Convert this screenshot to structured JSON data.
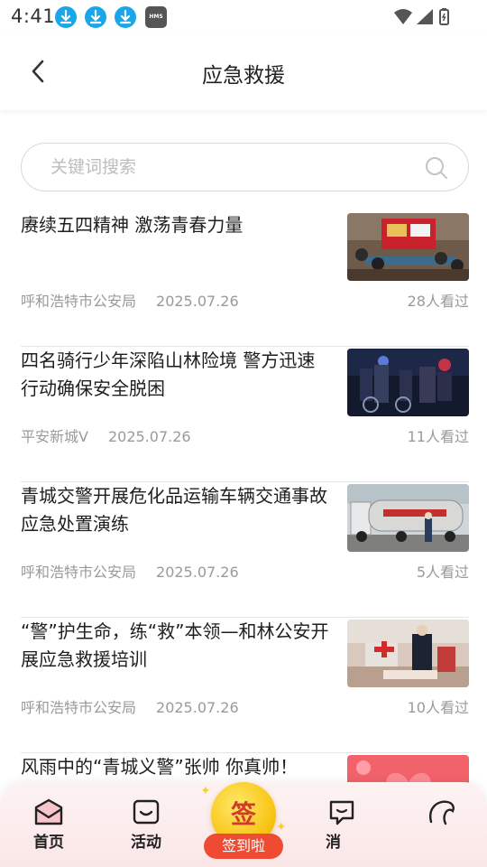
{
  "status_bar": {
    "time": "4:41",
    "hms_label": "HMS"
  },
  "header": {
    "title": "应急救援"
  },
  "search": {
    "placeholder": "关键词搜索"
  },
  "news": [
    {
      "title": "赓续五四精神 激荡青春力量",
      "source": "呼和浩特市公安局",
      "date": "2025.07.26",
      "views": "28人看过"
    },
    {
      "title": "四名骑行少年深陷山林险境 警方迅速行动确保安全脱困",
      "source": "平安新城V",
      "date": "2025.07.26",
      "views": "11人看过"
    },
    {
      "title": "青城交警开展危化品运输车辆交通事故应急处置演练",
      "source": "呼和浩特市公安局",
      "date": "2025.07.26",
      "views": "5人看过"
    },
    {
      "title": "“警”护生命，练“救”本领—和林公安开展应急救援培训",
      "source": "呼和浩特市公安局",
      "date": "2025.07.26",
      "views": "10人看过"
    },
    {
      "title": "风雨中的“青城义警”张帅 你真帅！",
      "source": "",
      "date": "",
      "views": ""
    }
  ],
  "bottom_nav": {
    "home": "首页",
    "activity": "活动",
    "sign_char": "签",
    "sign_label": "签到啦",
    "messages": "消"
  },
  "colors": {
    "accent_blue": "#1aa6e8",
    "sign_red": "#ee4b32",
    "sign_gold": "#f7c10c"
  }
}
